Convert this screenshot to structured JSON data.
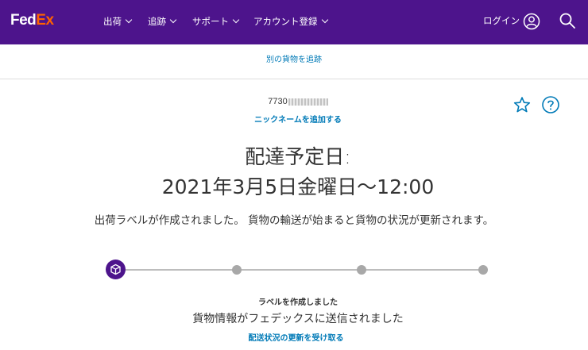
{
  "header": {
    "logo": {
      "fed": "Fed",
      "ex": "Ex"
    },
    "nav": [
      {
        "label": "出荷"
      },
      {
        "label": "追跡"
      },
      {
        "label": "サポート"
      },
      {
        "label": "アカウント登録"
      }
    ],
    "login_label": "ログイン"
  },
  "subbar": {
    "track_another_label": "別の貨物を追跡"
  },
  "shipment": {
    "tracking_number_visible": "7730",
    "add_nickname_label": "ニックネームを追加する",
    "delivery_heading": "配達予定日:",
    "delivery_date": "2021年3月5日金曜日～12:00",
    "status_message": "出荷ラベルが作成されました。 貨物の輸送が始まると貨物の状況が更新されます。"
  },
  "progress": {
    "current_step_index": 0,
    "total_steps": 4,
    "current_step_title": "ラベルを作成しました",
    "current_step_description": "貨物情報がフェデックスに送信されました"
  },
  "actions": {
    "receive_updates_label": "配送状況の更新を受け取る"
  },
  "colors": {
    "brand_purple": "#4d148c",
    "brand_orange": "#ff6200",
    "link_blue": "#007ab7"
  },
  "icons": [
    "user-icon",
    "search-icon",
    "star-icon",
    "help-icon",
    "package-icon",
    "chevron-down-icon"
  ]
}
